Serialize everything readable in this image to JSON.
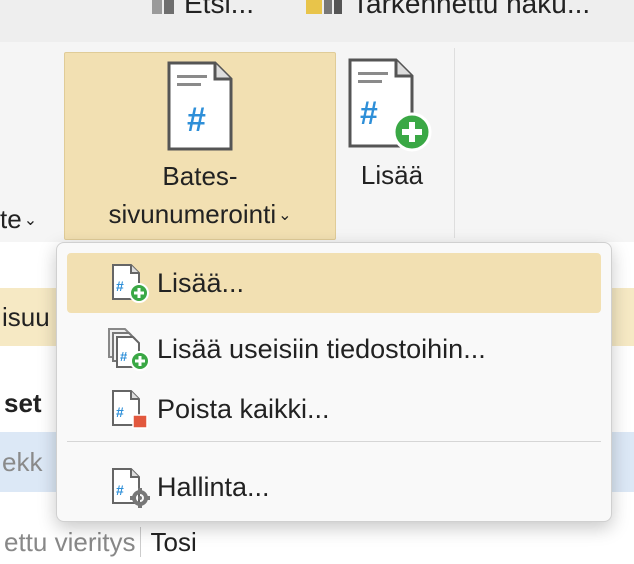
{
  "toolbar_top": {
    "search_label": "Etsi...",
    "advanced_label": "Tarkennettu haku..."
  },
  "ribbon": {
    "left_cut_label": "te",
    "bates": {
      "line1": "Bates-",
      "line2": "sivunumerointi",
      "chevron": "⌄"
    },
    "add_label": "Lisää"
  },
  "background": {
    "row_yellow": "isuu",
    "row_head": "set",
    "row_blue": "ekk",
    "row_last_key": "ettu vieritys",
    "row_last_value": "Tosi"
  },
  "menu": {
    "items": [
      {
        "label": "Lisää...",
        "icon": "bates-add-icon",
        "highlighted": true
      },
      {
        "label": "Lisää useisiin tiedostoihin...",
        "icon": "bates-add-multiple-icon",
        "highlighted": false
      },
      {
        "label": "Poista kaikki...",
        "icon": "bates-remove-icon",
        "highlighted": false
      },
      {
        "label": "Hallinta...",
        "icon": "bates-manage-icon",
        "highlighted": false
      }
    ]
  },
  "colors": {
    "highlight": "#f2e0b2",
    "hash_blue": "#2e8fd8",
    "add_green": "#3aa845",
    "remove_red": "#e2583e"
  }
}
